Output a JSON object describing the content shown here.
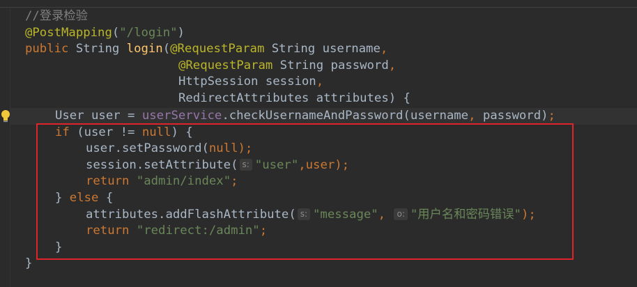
{
  "code": {
    "comment": "//登录检验",
    "annotation_post": "@PostMapping",
    "post_paren_open": "(",
    "post_path": "\"/login\"",
    "post_paren_close": ")",
    "kw_public": "public",
    "type_string": " String ",
    "method_login": "login",
    "paren_open": "(",
    "annotation_param": "@RequestParam",
    "param_username": " String username",
    "comma": ",",
    "param_password": " String password",
    "param_session": "HttpSession session",
    "param_attributes": "RedirectAttributes attributes) {",
    "decl_prefix": "User user = ",
    "field_userService": "userService",
    "call_check": ".checkUsernameAndPassword(username",
    "call_check_sep": ", ",
    "call_check_end": "password)",
    "semicolon": ";",
    "kw_if": "if",
    "if_cond_open": " (user != ",
    "kw_null": "null",
    "if_cond_close": ") {",
    "set_password": "user.setPassword(",
    "set_password_close": ");",
    "session_set": "session.setAttribute(",
    "hint_s": "s:",
    "str_user": "\"user\"",
    "session_set_end": ",user);",
    "kw_return": "return",
    "str_admin_index": " \"admin/index\"",
    "close_brace": "}",
    "kw_else": " else ",
    "open_brace": "{",
    "add_flash": "attributes.addFlashAttribute(",
    "str_message": "\"message\"",
    "hint_o": "o:",
    "str_error": "\"用户名和密码错误\"",
    "add_flash_end": ");",
    "str_redirect": " \"redirect:/admin\"",
    "end_brace": "}"
  },
  "colors": {
    "background": "#2b2b2b",
    "keyword": "#cc7832",
    "string": "#6a8759",
    "annotation": "#bbb529",
    "comment": "#808080",
    "method_decl": "#ffc66d",
    "field": "#9876aa",
    "highlight_box": "#e0242c"
  },
  "icons": {
    "intention_bulb": "lightbulb-icon"
  }
}
